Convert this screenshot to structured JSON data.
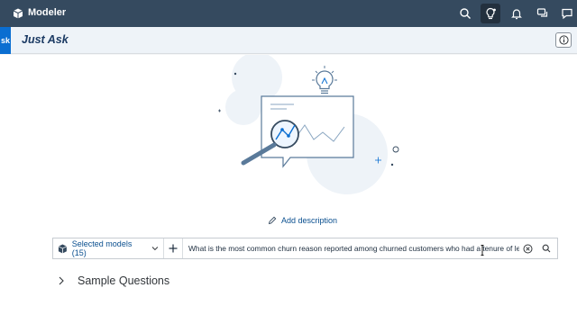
{
  "topbar": {
    "app_title": "Modeler",
    "icons": [
      "cube-logo-icon",
      "search-icon",
      "bulb-icon",
      "bell-icon",
      "chat-icon",
      "feedback-icon"
    ]
  },
  "header": {
    "side_tab_label": "sk",
    "title": "Just Ask",
    "info_icon": "info-icon"
  },
  "main": {
    "add_description_label": "Add description",
    "model_selector_label": "Selected models (15)",
    "query_text": "What is the most common churn reason reported among churned customers who had a tenure of le",
    "sample_questions_label": "Sample Questions"
  },
  "colors": {
    "shell": "#354a5f",
    "accent": "#0a6ed1",
    "link": "#0a4f8f",
    "header_bg": "#eef3f8"
  }
}
